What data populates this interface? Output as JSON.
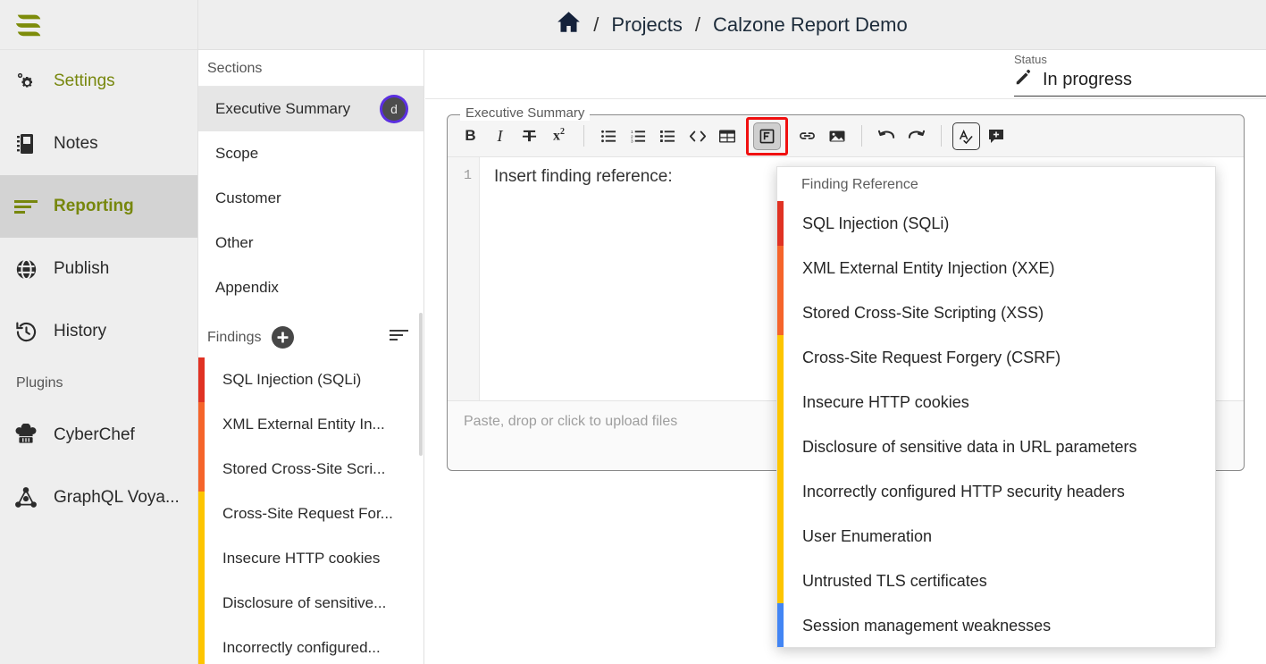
{
  "app": {
    "logo_name": "sysreptor-logo"
  },
  "topbar": {
    "home_label": "home-icon",
    "sep": "/",
    "crumb_projects": "Projects",
    "crumb_project": "Calzone Report Demo"
  },
  "rail": {
    "items": [
      {
        "label": "Settings",
        "icon": "gear-icon",
        "state": "accent"
      },
      {
        "label": "Notes",
        "icon": "notebook-icon",
        "state": "normal"
      },
      {
        "label": "Reporting",
        "icon": "report-lines-icon",
        "state": "active"
      },
      {
        "label": "Publish",
        "icon": "globe-icon",
        "state": "normal"
      },
      {
        "label": "History",
        "icon": "history-clock-icon",
        "state": "normal"
      }
    ],
    "plugins_label": "Plugins",
    "plugins": [
      {
        "label": "CyberChef",
        "icon": "chef-hat-icon"
      },
      {
        "label": "GraphQL Voya...",
        "icon": "graphql-icon"
      }
    ]
  },
  "sections": {
    "title": "Sections",
    "items": [
      {
        "label": "Executive Summary",
        "badge": "d",
        "active": true
      },
      {
        "label": "Scope",
        "badge": "",
        "active": false
      },
      {
        "label": "Customer",
        "badge": "",
        "active": false
      },
      {
        "label": "Other",
        "badge": "",
        "active": false
      },
      {
        "label": "Appendix",
        "badge": "",
        "active": false
      }
    ]
  },
  "findings_panel": {
    "title": "Findings",
    "add_label": "+",
    "sort_icon": "sort-icon",
    "items": [
      {
        "label": "SQL Injection (SQLi)",
        "severity_color": "#e03223"
      },
      {
        "label": "XML External Entity In...",
        "severity_color": "#f5642a"
      },
      {
        "label": "Stored Cross-Site Scri...",
        "severity_color": "#f5642a"
      },
      {
        "label": "Cross-Site Request For...",
        "severity_color": "#fdc500"
      },
      {
        "label": "Insecure HTTP cookies",
        "severity_color": "#fdc500"
      },
      {
        "label": "Disclosure of sensitive...",
        "severity_color": "#fdc500"
      },
      {
        "label": "Incorrectly configured...",
        "severity_color": "#fdc500"
      }
    ]
  },
  "status": {
    "label": "Status",
    "value": "In progress",
    "icon": "pencil-icon"
  },
  "editor": {
    "legend": "Executive Summary",
    "line_number": "1",
    "content": "Insert finding reference:",
    "dropzone_placeholder": "Paste, drop or click to upload files",
    "toolbar": [
      {
        "name": "bold-button",
        "glyph": "B",
        "kind": "bold"
      },
      {
        "name": "italic-button",
        "glyph": "I",
        "kind": "ital"
      },
      {
        "name": "strikethrough-button",
        "glyph": "strikethrough-icon",
        "kind": "svg"
      },
      {
        "name": "superscript-button",
        "glyph": "x²",
        "kind": "sup"
      },
      {
        "name": "bullet-list-button",
        "glyph": "bullet-list-icon",
        "kind": "svg"
      },
      {
        "name": "numbered-list-button",
        "glyph": "numbered-list-icon",
        "kind": "svg"
      },
      {
        "name": "todo-list-button",
        "glyph": "todo-list-icon",
        "kind": "svg"
      },
      {
        "name": "code-button",
        "glyph": "<>",
        "kind": "code"
      },
      {
        "name": "table-button",
        "glyph": "table-icon",
        "kind": "svg"
      },
      {
        "name": "finding-reference-button",
        "glyph": "finding-reference-icon",
        "kind": "svg"
      },
      {
        "name": "link-button",
        "glyph": "link-icon",
        "kind": "svg"
      },
      {
        "name": "image-button",
        "glyph": "image-icon",
        "kind": "svg"
      },
      {
        "name": "undo-button",
        "glyph": "undo-icon",
        "kind": "svg"
      },
      {
        "name": "redo-button",
        "glyph": "redo-icon",
        "kind": "svg"
      },
      {
        "name": "spellcheck-button",
        "glyph": "spellcheck-icon",
        "kind": "svg"
      },
      {
        "name": "comment-button",
        "glyph": "add-comment-icon",
        "kind": "svg"
      }
    ]
  },
  "finding_reference_menu": {
    "title": "Finding Reference",
    "items": [
      {
        "label": "SQL Injection (SQLi)",
        "severity_color": "#e03223"
      },
      {
        "label": "XML External Entity Injection (XXE)",
        "severity_color": "#f5642a"
      },
      {
        "label": "Stored Cross-Site Scripting (XSS)",
        "severity_color": "#f5642a"
      },
      {
        "label": "Cross-Site Request Forgery (CSRF)",
        "severity_color": "#fdc500"
      },
      {
        "label": "Insecure HTTP cookies",
        "severity_color": "#fdc500"
      },
      {
        "label": "Disclosure of sensitive data in URL parameters",
        "severity_color": "#fdc500"
      },
      {
        "label": "Incorrectly configured HTTP security headers",
        "severity_color": "#fdc500"
      },
      {
        "label": "User Enumeration",
        "severity_color": "#fdc500"
      },
      {
        "label": "Untrusted TLS certificates",
        "severity_color": "#fdc500"
      },
      {
        "label": "Session management weaknesses",
        "severity_color": "#4285f4"
      }
    ]
  },
  "colors": {
    "brand": "#77870d",
    "critical": "#e03223",
    "high": "#f5642a",
    "medium": "#fdc500",
    "low": "#4285f4",
    "highlight_box": "#f01010",
    "badge_ring": "#5b2fe0"
  }
}
